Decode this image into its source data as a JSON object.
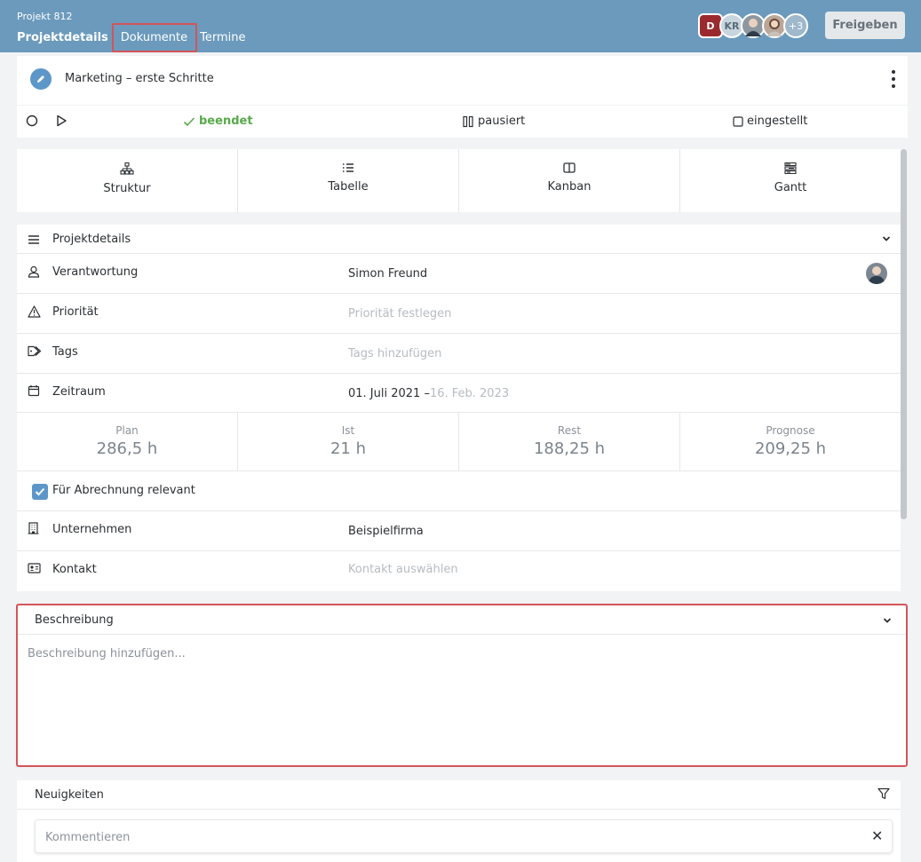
{
  "header": {
    "project_number": "Projekt 812",
    "tabs": [
      {
        "label": "Projektdetails"
      },
      {
        "label": "Dokumente"
      },
      {
        "label": "Termine"
      }
    ],
    "avatars": {
      "d": "D",
      "kr": "KR",
      "more": "+3"
    },
    "share_label": "Freigeben"
  },
  "task": {
    "title": "Marketing – erste Schritte"
  },
  "status": {
    "done": "beendet",
    "paused": "pausiert",
    "set": "eingestellt"
  },
  "views": [
    {
      "label": "Struktur"
    },
    {
      "label": "Tabelle"
    },
    {
      "label": "Kanban"
    },
    {
      "label": "Gantt"
    }
  ],
  "details": {
    "section_title": "Projektdetails",
    "responsibility": {
      "label": "Verantwortung",
      "value": "Simon Freund"
    },
    "priority": {
      "label": "Priorität",
      "placeholder": "Priorität festlegen"
    },
    "tags": {
      "label": "Tags",
      "placeholder": "Tags hinzufügen"
    },
    "period": {
      "label": "Zeitraum",
      "start": "01. Juli 2021 –",
      "end": "16. Feb. 2023"
    },
    "stats": [
      {
        "label": "Plan",
        "value": "286,5 h"
      },
      {
        "label": "Ist",
        "value": "21 h"
      },
      {
        "label": "Rest",
        "value": "188,25 h"
      },
      {
        "label": "Prognose",
        "value": "209,25 h"
      }
    ],
    "billing": {
      "label": "Für Abrechnung relevant",
      "checked": true
    },
    "company": {
      "label": "Unternehmen",
      "value": "Beispielfirma"
    },
    "contact": {
      "label": "Kontakt",
      "placeholder": "Kontakt auswählen"
    }
  },
  "description": {
    "title": "Beschreibung",
    "placeholder": "Beschreibung hinzufügen..."
  },
  "news": {
    "title": "Neuigkeiten",
    "comment_placeholder": "Kommentieren"
  },
  "colors": {
    "header": "#6b9abd",
    "accent": "#5d97c9",
    "done": "#58a94b",
    "highlight": "#d4545a"
  }
}
